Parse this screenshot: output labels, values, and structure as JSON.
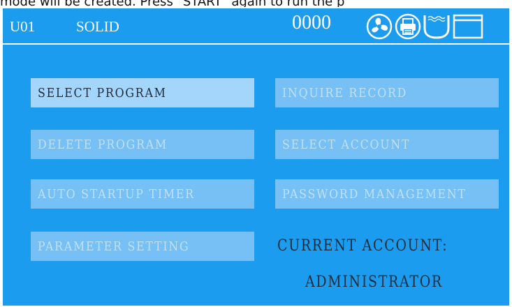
{
  "caption": "mode will be created. Press \"START\" again to run the p",
  "status": {
    "unit": "U01",
    "mode": "SOLID",
    "counter": "0000",
    "icons": [
      "fan-icon",
      "printer-icon",
      "water-tank-icon",
      "display-icon"
    ]
  },
  "menu": {
    "select_program": "SELECT PROGRAM",
    "inquire_record": "INQUIRE RECORD",
    "delete_program": "DELETE PROGRAM",
    "select_account": "SELECT ACCOUNT",
    "auto_startup_timer": "AUTO STARTUP TIMER",
    "password_management": "PASSWORD MANAGEMENT",
    "parameter_setting": "PARAMETER SETTING"
  },
  "account": {
    "label": "CURRENT ACCOUNT:",
    "name": "ADMINISTRATOR"
  },
  "colors": {
    "screen_bg": "#1b9cef",
    "button_active": "#a4d5fb",
    "button_disabled": "#76c0f5"
  }
}
